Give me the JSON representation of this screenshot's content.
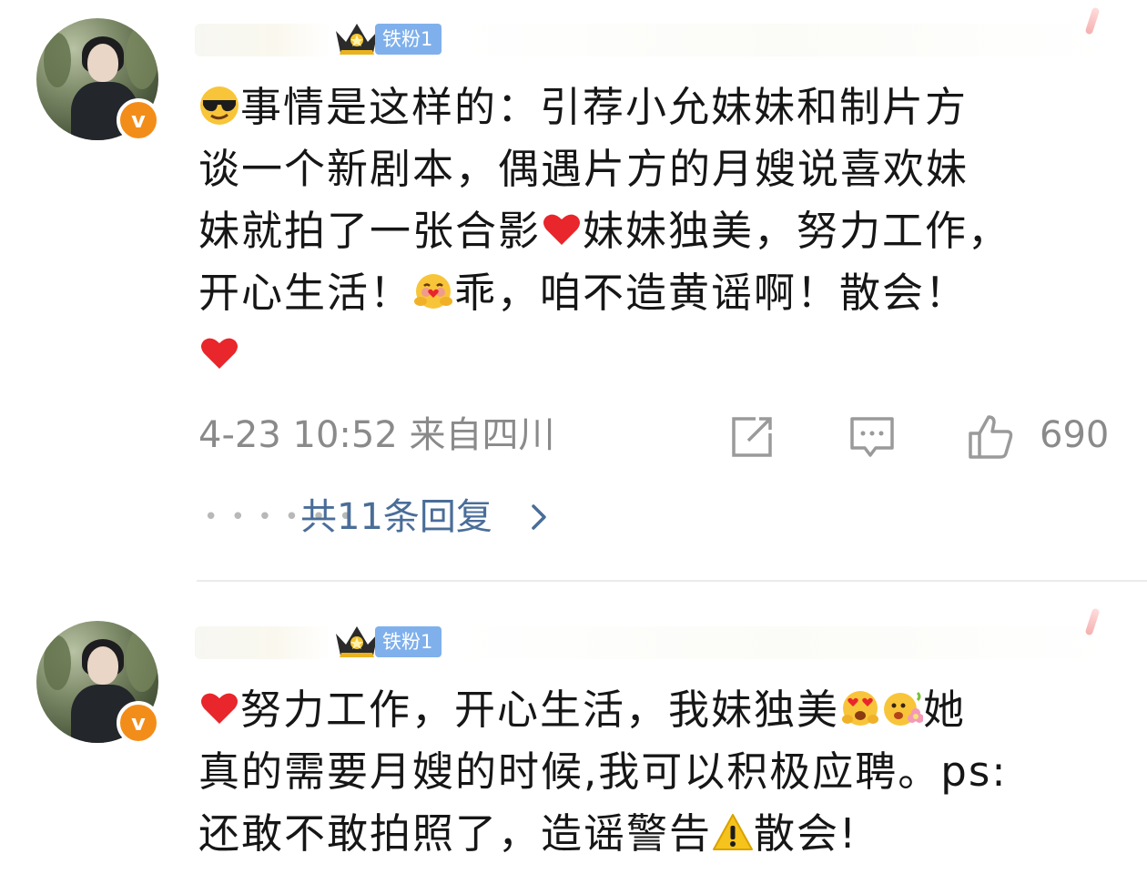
{
  "comments": [
    {
      "fan_badge": "铁粉1",
      "lines": [
        "事情是这样的：引荐小允妹妹和制片方",
        "谈一个新剧本，偶遇片方的月嫂说喜欢妹",
        "妹就拍了一张合影",
        "妹妹独美，努力工作，",
        "开心生活！",
        "乖，咱不造黄谣啊！散会！"
      ],
      "time": "4-23 10:52",
      "location": "来自四川",
      "like_count": "690",
      "replies_label": "共11条回复",
      "icons": [
        "sunglasses-emoji",
        "heart-emoji",
        "hug-emoji",
        "heart-emoji",
        "share-icon",
        "comment-icon",
        "like-icon",
        "chevron-right-icon"
      ]
    },
    {
      "fan_badge": "铁粉1",
      "lines": [
        "努力工作，开心生活，我妹独美",
        "她",
        "真的需要月嫂的时候,我可以积极应聘。ps:",
        "还敢不敢拍照了，造谣警告",
        "散会!"
      ],
      "icons": [
        "heart-emoji",
        "heart-eyes-emoji",
        "flower-smile-emoji",
        "warning-emoji"
      ]
    }
  ],
  "colors": {
    "verified_badge": "#f38d1a",
    "fan_badge_bg": "#7fb0ec",
    "link": "#4a6d98",
    "meta_text": "#8a8a8a",
    "heart": "#e8262b"
  }
}
